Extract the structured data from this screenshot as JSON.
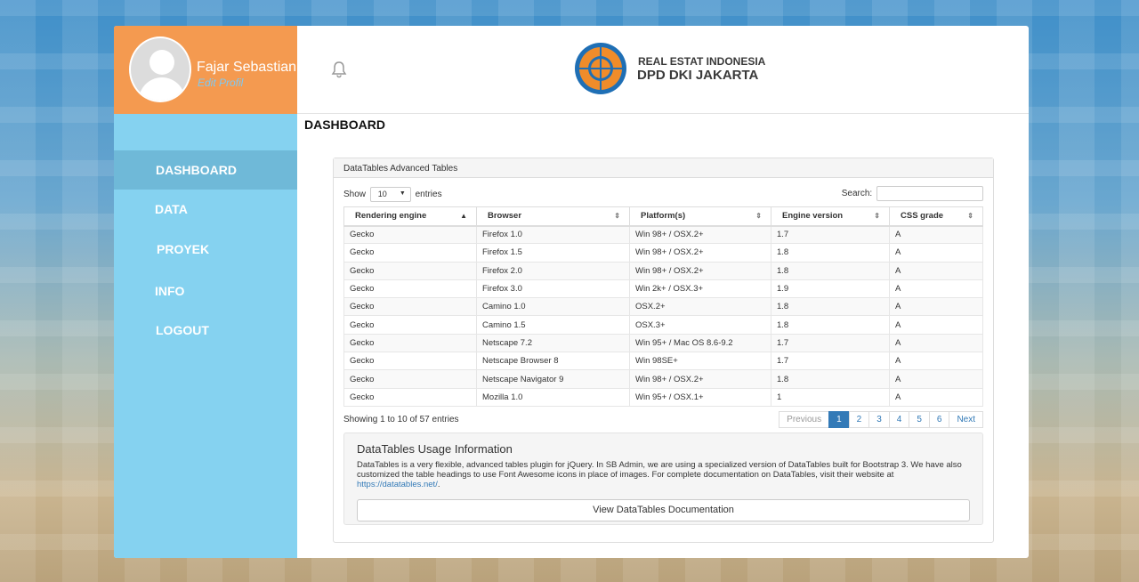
{
  "user": {
    "name": "Fajar Sebastian",
    "edit_label": "Edit Profil"
  },
  "nav": [
    {
      "label": "DASHBOARD",
      "active": true
    },
    {
      "label": "DATA"
    },
    {
      "label": "PROYEK"
    },
    {
      "label": "INFO"
    },
    {
      "label": "LOGOUT"
    }
  ],
  "brand": {
    "line1": "REAL ESTAT INDONESIA",
    "line2": "DPD DKI JAKARTA"
  },
  "page_title": "DASHBOARD",
  "table_card": {
    "title": "DataTables Advanced Tables",
    "show_label": "Show",
    "entries_value": "10",
    "entries_label": "entries",
    "search_label": "Search:",
    "columns": [
      "Rendering engine",
      "Browser",
      "Platform(s)",
      "Engine version",
      "CSS grade"
    ],
    "rows": [
      [
        "Gecko",
        "Firefox 1.0",
        "Win 98+ / OSX.2+",
        "1.7",
        "A"
      ],
      [
        "Gecko",
        "Firefox 1.5",
        "Win 98+ / OSX.2+",
        "1.8",
        "A"
      ],
      [
        "Gecko",
        "Firefox 2.0",
        "Win 98+ / OSX.2+",
        "1.8",
        "A"
      ],
      [
        "Gecko",
        "Firefox 3.0",
        "Win 2k+ / OSX.3+",
        "1.9",
        "A"
      ],
      [
        "Gecko",
        "Camino 1.0",
        "OSX.2+",
        "1.8",
        "A"
      ],
      [
        "Gecko",
        "Camino 1.5",
        "OSX.3+",
        "1.8",
        "A"
      ],
      [
        "Gecko",
        "Netscape 7.2",
        "Win 95+ / Mac OS 8.6-9.2",
        "1.7",
        "A"
      ],
      [
        "Gecko",
        "Netscape Browser 8",
        "Win 98SE+",
        "1.7",
        "A"
      ],
      [
        "Gecko",
        "Netscape Navigator 9",
        "Win 98+ / OSX.2+",
        "1.8",
        "A"
      ],
      [
        "Gecko",
        "Mozilla 1.0",
        "Win 95+ / OSX.1+",
        "1",
        "A"
      ]
    ],
    "info": "Showing 1 to 10 of 57 entries",
    "pagination": [
      "Previous",
      "1",
      "2",
      "3",
      "4",
      "5",
      "6",
      "Next"
    ],
    "current_page": "1"
  },
  "usage": {
    "title": "DataTables Usage Information",
    "text": "DataTables is a very flexible, advanced tables plugin for jQuery. In SB Admin, we are using a specialized version of DataTables built for Bootstrap 3. We have also customized the table headings to use Font Awesome icons in place of images. For complete documentation on DataTables, visit their website at ",
    "link": "https://datatables.net/",
    "link_suffix": ".",
    "button": "View DataTables Documentation"
  },
  "colors": {
    "sidebar": "#85d2f0",
    "profile": "#f49a50",
    "accent": "#337ab7",
    "logo": "#f08c2a"
  }
}
